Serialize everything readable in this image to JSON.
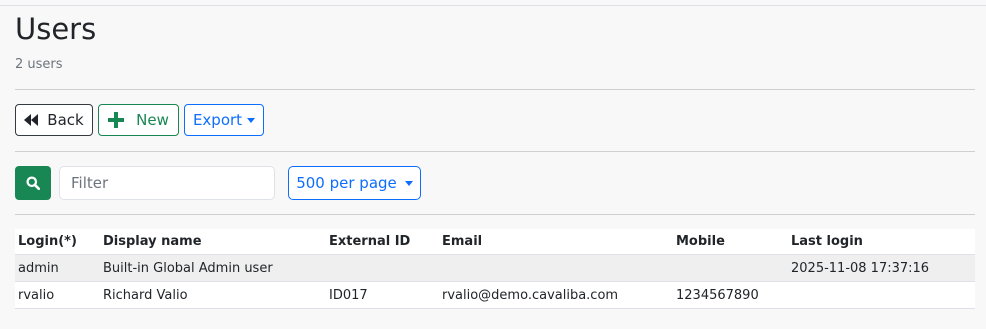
{
  "page": {
    "title": "Users",
    "subtitle": "2 users"
  },
  "toolbar": {
    "back_label": "Back",
    "new_label": "New",
    "export_label": "Export"
  },
  "search": {
    "placeholder": "Filter",
    "per_page_label": "500 per page"
  },
  "table": {
    "columns": [
      "Login(*)",
      "Display name",
      "External ID",
      "Email",
      "Mobile",
      "Last login"
    ],
    "rows": [
      [
        "admin",
        "Built-in Global Admin user",
        "",
        "",
        "",
        "2025-11-08 17:37:16"
      ],
      [
        "rvalio",
        "Richard Valio",
        "ID017",
        "rvalio@demo.cavaliba.com",
        "1234567890",
        ""
      ]
    ]
  },
  "icons": {
    "back": "fast-backward-icon",
    "new": "plus-icon",
    "export": "caret-down-icon",
    "search": "search-icon",
    "per_page": "caret-down-icon"
  },
  "colors": {
    "success": "#198754",
    "primary": "#0d6efd",
    "dark": "#343a40"
  }
}
